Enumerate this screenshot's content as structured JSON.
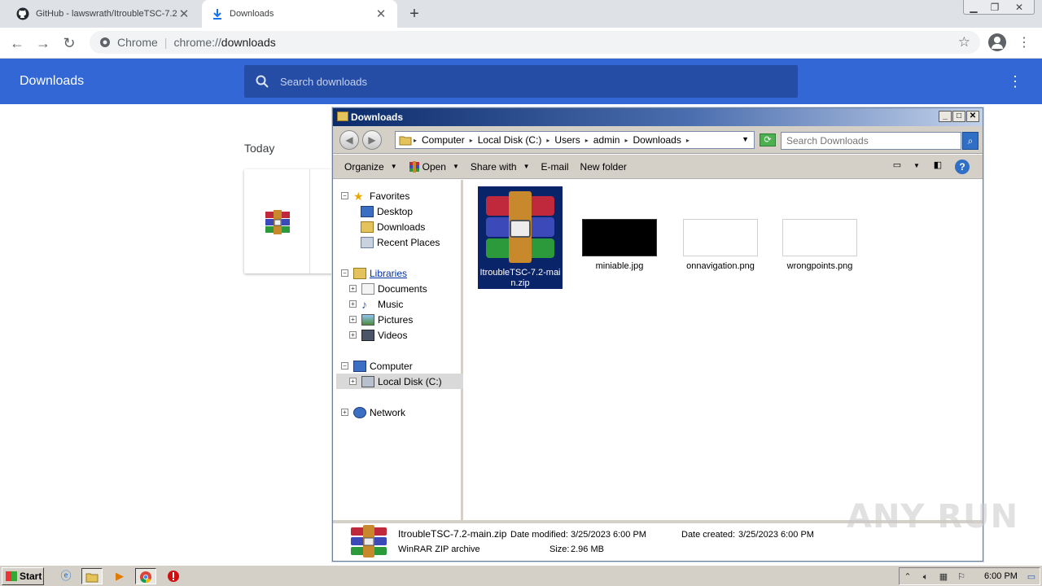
{
  "browser": {
    "tabs": [
      {
        "title": "GitHub - lawswrath/ItroubleTSC-7.2",
        "icon": "github-icon"
      },
      {
        "title": "Downloads",
        "icon": "download-icon",
        "active": true
      }
    ],
    "omnibox": {
      "chip": "Chrome",
      "url_scheme": "chrome://",
      "url_path": "downloads"
    }
  },
  "downloads_page": {
    "title": "Downloads",
    "search_placeholder": "Search downloads",
    "section": "Today",
    "accent_color": "#3367d6"
  },
  "explorer": {
    "title": "Downloads",
    "breadcrumb": [
      "Computer",
      "Local Disk (C:)",
      "Users",
      "admin",
      "Downloads"
    ],
    "search_placeholder": "Search Downloads",
    "commands": [
      "Organize",
      "Open",
      "Share with",
      "E-mail",
      "New folder"
    ],
    "nav": {
      "favorites": {
        "label": "Favorites",
        "items": [
          "Desktop",
          "Downloads",
          "Recent Places"
        ]
      },
      "libraries": {
        "label": "Libraries",
        "items": [
          "Documents",
          "Music",
          "Pictures",
          "Videos"
        ]
      },
      "computer": {
        "label": "Computer",
        "items": [
          "Local Disk (C:)"
        ]
      },
      "network": {
        "label": "Network"
      }
    },
    "files": [
      {
        "name": "ItroubleTSC-7.2-main.zip",
        "type": "zip",
        "selected": true
      },
      {
        "name": "miniable.jpg",
        "type": "image-dark"
      },
      {
        "name": "onnavigation.png",
        "type": "image-light"
      },
      {
        "name": "wrongpoints.png",
        "type": "image-light"
      }
    ],
    "details": {
      "filename": "ItroubleTSC-7.2-main.zip",
      "filetype": "WinRAR ZIP archive",
      "modified_label": "Date modified:",
      "modified_value": "3/25/2023 6:00 PM",
      "size_label": "Size:",
      "size_value": "2.96 MB",
      "created_label": "Date created:",
      "created_value": "3/25/2023 6:00 PM"
    }
  },
  "taskbar": {
    "start_label": "Start",
    "clock": "6:00 PM"
  },
  "watermark": "ANY RUN"
}
